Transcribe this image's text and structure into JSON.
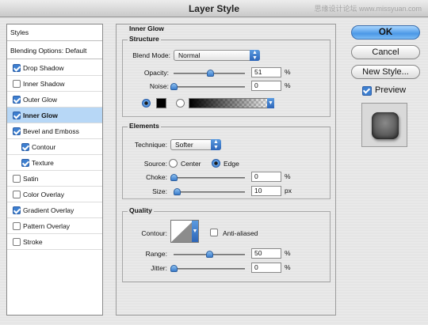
{
  "window": {
    "title": "Layer Style",
    "watermark": "思缘设计论坛 www.missyuan.com"
  },
  "styles_list": {
    "header": "Styles",
    "blending_options": "Blending Options: Default",
    "items": [
      {
        "label": "Drop Shadow",
        "checked": true,
        "selected": false,
        "bold": false,
        "indent": false
      },
      {
        "label": "Inner Shadow",
        "checked": false,
        "selected": false,
        "bold": false,
        "indent": false
      },
      {
        "label": "Outer Glow",
        "checked": true,
        "selected": false,
        "bold": false,
        "indent": false
      },
      {
        "label": "Inner Glow",
        "checked": true,
        "selected": true,
        "bold": true,
        "indent": false
      },
      {
        "label": "Bevel and Emboss",
        "checked": true,
        "selected": false,
        "bold": false,
        "indent": false
      },
      {
        "label": "Contour",
        "checked": true,
        "selected": false,
        "bold": false,
        "indent": true
      },
      {
        "label": "Texture",
        "checked": true,
        "selected": false,
        "bold": false,
        "indent": true
      },
      {
        "label": "Satin",
        "checked": false,
        "selected": false,
        "bold": false,
        "indent": false
      },
      {
        "label": "Color Overlay",
        "checked": false,
        "selected": false,
        "bold": false,
        "indent": false
      },
      {
        "label": "Gradient Overlay",
        "checked": true,
        "selected": false,
        "bold": false,
        "indent": false
      },
      {
        "label": "Pattern Overlay",
        "checked": false,
        "selected": false,
        "bold": false,
        "indent": false
      },
      {
        "label": "Stroke",
        "checked": false,
        "selected": false,
        "bold": false,
        "indent": false
      }
    ]
  },
  "inner_glow": {
    "title": "Inner Glow",
    "structure": {
      "title": "Structure",
      "blend_mode_label": "Blend Mode:",
      "blend_mode_value": "Normal",
      "opacity_label": "Opacity:",
      "opacity_value": "51",
      "opacity_level": 0.51,
      "noise_label": "Noise:",
      "noise_value": "0",
      "noise_level": 0,
      "percent": "%",
      "color_radio_selected": true,
      "gradient_radio_selected": false,
      "glow_color": "#000000"
    },
    "elements": {
      "title": "Elements",
      "technique_label": "Technique:",
      "technique_value": "Softer",
      "source_label": "Source:",
      "source_center": "Center",
      "source_edge": "Edge",
      "source_selected": "Edge",
      "choke_label": "Choke:",
      "choke_value": "0",
      "choke_level": 0,
      "size_label": "Size:",
      "size_value": "10",
      "size_level": 0.04,
      "percent": "%",
      "px": "px"
    },
    "quality": {
      "title": "Quality",
      "contour_label": "Contour:",
      "anti_aliased_label": "Anti-aliased",
      "anti_aliased": false,
      "range_label": "Range:",
      "range_value": "50",
      "range_level": 0.5,
      "jitter_label": "Jitter:",
      "jitter_value": "0",
      "jitter_level": 0,
      "percent": "%"
    }
  },
  "actions": {
    "ok": "OK",
    "cancel": "Cancel",
    "new_style": "New Style...",
    "preview_label": "Preview",
    "preview_checked": true
  },
  "colors": {
    "accent": "#3d7fd0",
    "selected_row": "#b7d7f6"
  }
}
